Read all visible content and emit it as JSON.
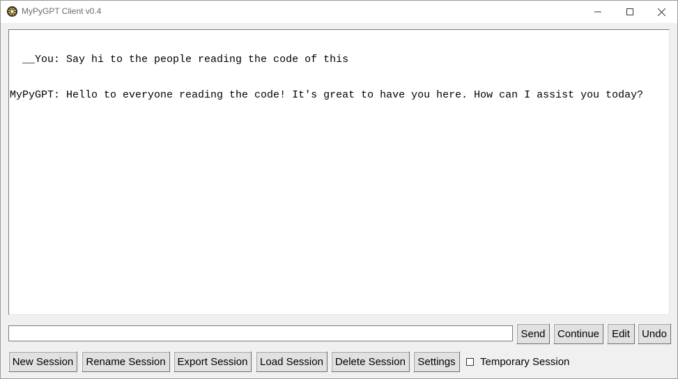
{
  "window": {
    "title": "MyPyGPT Client v0.4",
    "icon": "app-icon"
  },
  "chat": {
    "lines": [
      "  __You: Say hi to the people reading the code of this",
      "MyPyGPT: Hello to everyone reading the code! It's great to have you here. How can I assist you today?"
    ]
  },
  "input": {
    "value": "",
    "placeholder": ""
  },
  "actions": {
    "send": "Send",
    "continue": "Continue",
    "edit": "Edit",
    "undo": "Undo"
  },
  "session": {
    "new": "New Session",
    "rename": "Rename Session",
    "export": "Export Session",
    "load": "Load Session",
    "delete": "Delete Session",
    "settings": "Settings",
    "temporary_label": "Temporary Session",
    "temporary_checked": false
  }
}
